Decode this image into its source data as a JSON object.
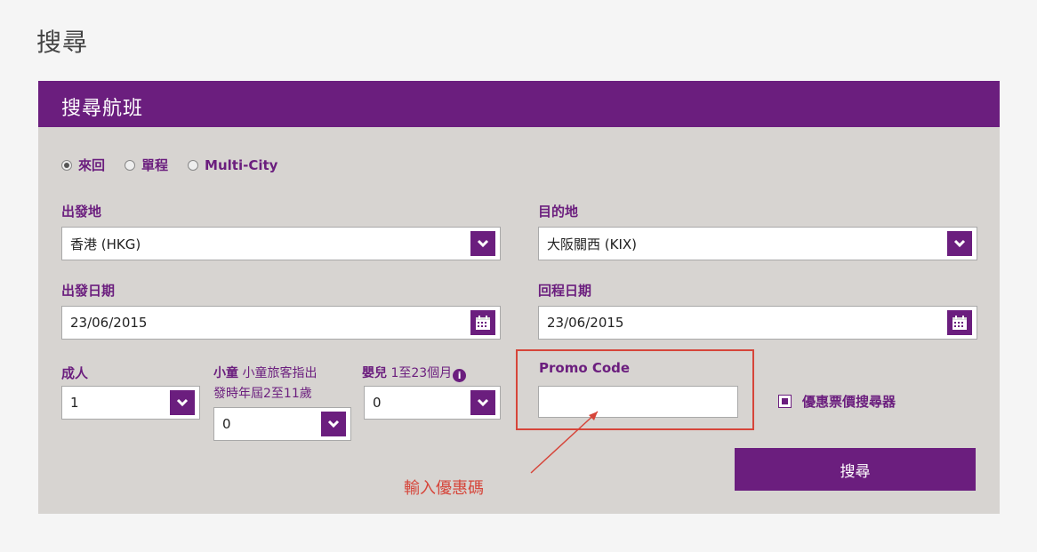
{
  "page": {
    "title": "搜尋"
  },
  "panel": {
    "title": "搜尋航班"
  },
  "trip_type": {
    "options": [
      {
        "label": "來回",
        "selected": true
      },
      {
        "label": "單程",
        "selected": false
      },
      {
        "label": "Multi-City",
        "selected": false
      }
    ]
  },
  "origin": {
    "label": "出發地",
    "value": "香港 (HKG)"
  },
  "destination": {
    "label": "目的地",
    "value": "大阪關西 (KIX)"
  },
  "depart_date": {
    "label": "出發日期",
    "value": "23/06/2015"
  },
  "return_date": {
    "label": "回程日期",
    "value": "23/06/2015"
  },
  "adults": {
    "label": "成人",
    "value": "1"
  },
  "children": {
    "label": "小童",
    "note_line1": "小童旅客指出",
    "note_line2": "發時年屆2至11歲",
    "value": "0"
  },
  "infants": {
    "label": "嬰兒",
    "note": "1至23個月",
    "value": "0"
  },
  "promo": {
    "label": "Promo Code",
    "value": ""
  },
  "fare_finder": {
    "label": "優惠票價搜尋器",
    "checked": true
  },
  "search_button": {
    "label": "搜尋"
  },
  "annotation": {
    "text": "輸入優惠碼"
  },
  "colors": {
    "brand": "#6b1e7e",
    "annotation": "#d6453a",
    "panel": "#d7d4d1"
  },
  "icons": {
    "dropdown": "chevron-down-icon",
    "calendar": "calendar-icon",
    "info": "info-icon"
  }
}
